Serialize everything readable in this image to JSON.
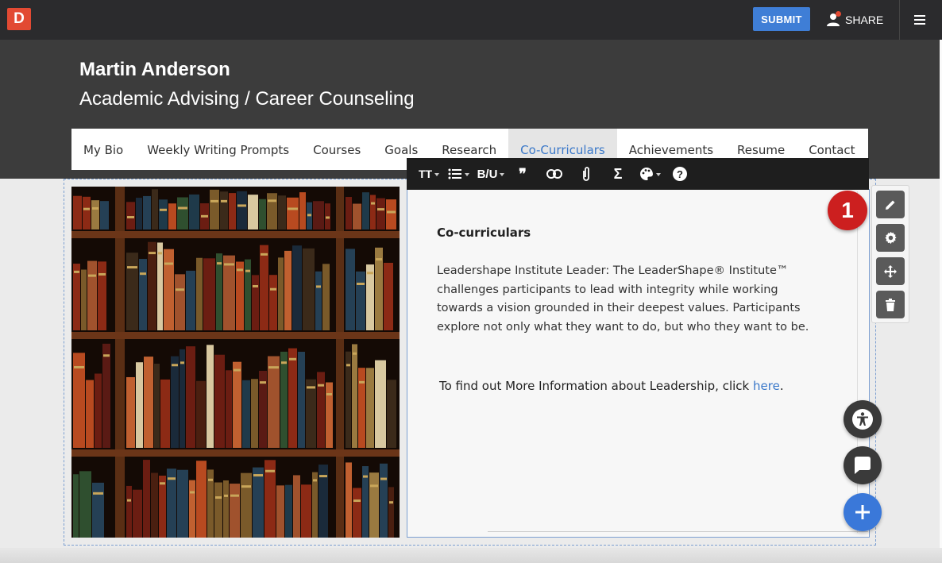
{
  "topbar": {
    "logo": "D",
    "submit_label": "SUBMIT",
    "share_label": "SHARE"
  },
  "header": {
    "name": "Martin Anderson",
    "subtitle": "Academic Advising / Career Counseling"
  },
  "nav": {
    "items": [
      "My Bio",
      "Weekly Writing Prompts",
      "Courses",
      "Goals",
      "Research",
      "Co-Curriculars",
      "Achievements",
      "Resume",
      "Contact"
    ],
    "active": "Co-Curriculars"
  },
  "toolbar": {
    "text_size": "TT",
    "format": "B/U",
    "quote": "❞",
    "sigma": "Σ",
    "help": "?"
  },
  "editor": {
    "title": "Co-curriculars",
    "paragraph": "Leadershape Institute Leader: The LeaderShape® Institute™ challenges participants to lead with integrity while working towards a vision grounded in their deepest values. Participants explore not only what they want to do, but who they want to be.",
    "info_text": "To find out More Information about Leadership, click ",
    "link_text": "here",
    "info_suffix": "."
  },
  "badge": "1",
  "colors": {
    "accent": "#3a78c9",
    "submit": "#3f7ed6",
    "badge": "#cc1f1f",
    "logo": "#e24a33"
  }
}
